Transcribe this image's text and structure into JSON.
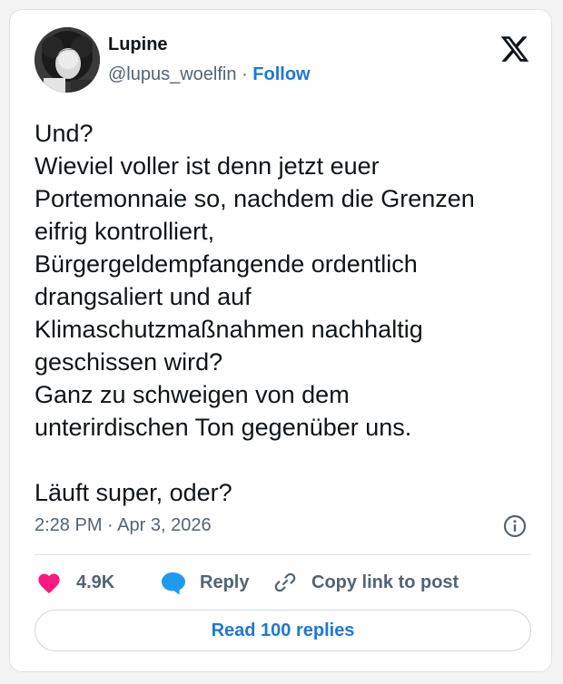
{
  "author": {
    "name": "Lupine",
    "handle": "@lupus_woelfin",
    "separator": "·",
    "follow_label": "Follow"
  },
  "post": {
    "lines": [
      "Und?",
      "Wieviel voller ist denn jetzt euer",
      "Portemonnaie so, nachdem die Grenzen",
      "eifrig kontrolliert,",
      "Bürgergeldempfangende ordentlich",
      "drangsaliert und auf",
      "Klimaschutzmaßnahmen nachhaltig",
      "geschissen wird?",
      "Ganz zu schweigen von dem",
      "unterirdischen Ton gegenüber uns.",
      "",
      "Läuft super, oder?"
    ],
    "timestamp": "2:28 PM · Apr 3, 2026"
  },
  "actions": {
    "like_count": "4.9K",
    "reply_label": "Reply",
    "copy_link_label": "Copy link to post"
  },
  "footer": {
    "read_replies_label": "Read 100 replies"
  },
  "colors": {
    "accent": "#1d78d6",
    "like": "#f91880",
    "reply_icon": "#1d9bf0",
    "muted": "#536471",
    "text": "#0f1419"
  },
  "icons": [
    "x-logo-icon",
    "info-icon",
    "heart-icon",
    "reply-bubble-icon",
    "link-icon"
  ]
}
